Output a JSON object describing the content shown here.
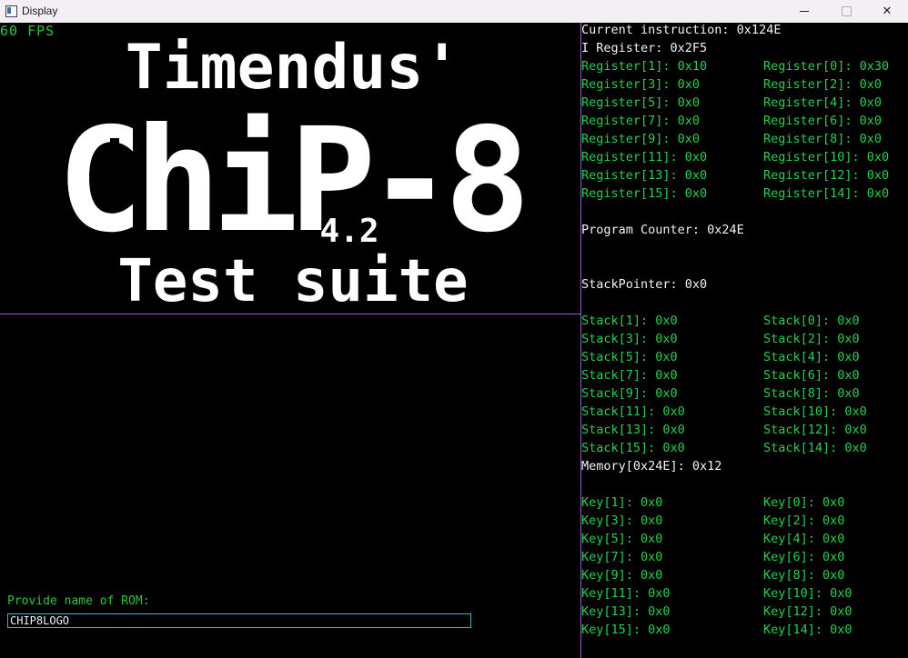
{
  "window": {
    "title": "Display"
  },
  "display": {
    "fps": "60 FPS",
    "screen_text": {
      "line1": "Timendus'",
      "line2": "ChiP-8",
      "version": "4.2",
      "line3": "Test suite"
    }
  },
  "registers": {
    "current_instruction": "Current instruction: 0x124E",
    "i_register": "I Register: 0x2F5",
    "left": [
      "Register[1]: 0x10",
      "Register[3]: 0x0",
      "Register[5]: 0x0",
      "Register[7]: 0x0",
      "Register[9]: 0x0",
      "Register[11]: 0x0",
      "Register[13]: 0x0",
      "Register[15]: 0x0"
    ],
    "right": [
      "Register[0]: 0x30",
      "Register[2]: 0x0",
      "Register[4]: 0x0",
      "Register[6]: 0x0",
      "Register[8]: 0x0",
      "Register[10]: 0x0",
      "Register[12]: 0x0",
      "Register[14]: 0x0"
    ],
    "program_counter": "Program Counter: 0x24E",
    "stack_pointer": "StackPointer: 0x0"
  },
  "stack": {
    "left": [
      "Stack[1]: 0x0",
      "Stack[3]: 0x0",
      "Stack[5]: 0x0",
      "Stack[7]: 0x0",
      "Stack[9]: 0x0",
      "Stack[11]: 0x0",
      "Stack[13]: 0x0",
      "Stack[15]: 0x0"
    ],
    "right": [
      "Stack[0]: 0x0",
      "Stack[2]: 0x0",
      "Stack[4]: 0x0",
      "Stack[6]: 0x0",
      "Stack[8]: 0x0",
      "Stack[10]: 0x0",
      "Stack[12]: 0x0",
      "Stack[14]: 0x0"
    ]
  },
  "memory": "Memory[0x24E]: 0x12",
  "keys": {
    "left": [
      "Key[1]: 0x0",
      "Key[3]: 0x0",
      "Key[5]: 0x0",
      "Key[7]: 0x0",
      "Key[9]: 0x0",
      "Key[11]: 0x0",
      "Key[13]: 0x0",
      "Key[15]: 0x0"
    ],
    "right": [
      "Key[0]: 0x0",
      "Key[2]: 0x0",
      "Key[4]: 0x0",
      "Key[6]: 0x0",
      "Key[8]: 0x0",
      "Key[10]: 0x0",
      "Key[12]: 0x0",
      "Key[14]: 0x0"
    ]
  },
  "rom": {
    "prompt": "Provide name of ROM:",
    "value": "CHIP8LOGO"
  },
  "colors": {
    "label_green": "#24d24a",
    "white": "#f2f2f2",
    "separator": "#8d5fd3",
    "input_border": "#35b8c8"
  }
}
